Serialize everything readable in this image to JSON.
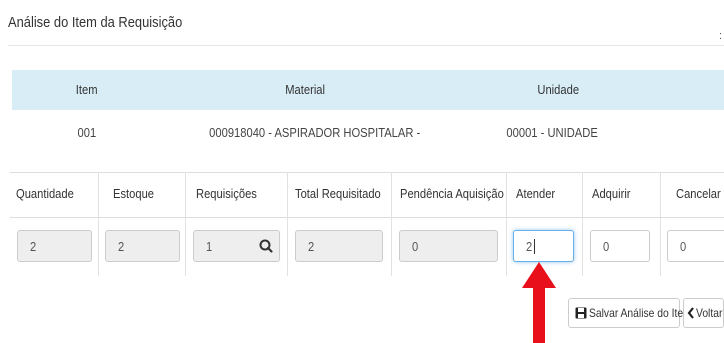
{
  "page": {
    "title": "Análise do Item da Requisição",
    "edge_mark": ":"
  },
  "item_table": {
    "headers": {
      "item": "Item",
      "material": "Material",
      "unidade": "Unidade"
    },
    "row": {
      "item": "001",
      "material": "000918040 - ASPIRADOR HOSPITALAR -",
      "unidade": "00001 - UNIDADE"
    }
  },
  "analysis_table": {
    "headers": {
      "quantidade": "Quantidade",
      "estoque": "Estoque",
      "requisicoes": "Requisições",
      "total_requisitado": "Total Requisitado",
      "pendencia_aquisicao": "Pendência Aquisição",
      "atender": "Atender",
      "adquirir": "Adquirir",
      "cancelar": "Cancelar"
    },
    "values": {
      "quantidade": "2",
      "estoque": "2",
      "requisicoes": "1",
      "total_requisitado": "2",
      "pendencia_aquisicao": "0",
      "atender": "2",
      "adquirir": "0",
      "cancelar": "0"
    }
  },
  "buttons": {
    "save": "Salvar Análise do Item",
    "back": "Voltar"
  },
  "icons": {
    "search": "search-icon",
    "save": "floppy-disk-icon",
    "back": "chevron-left-icon",
    "annotation": "red-arrow-up"
  },
  "colors": {
    "header_bg": "#d9edf7",
    "annotation_arrow": "#e8101a",
    "focus_border": "#66afe9"
  }
}
